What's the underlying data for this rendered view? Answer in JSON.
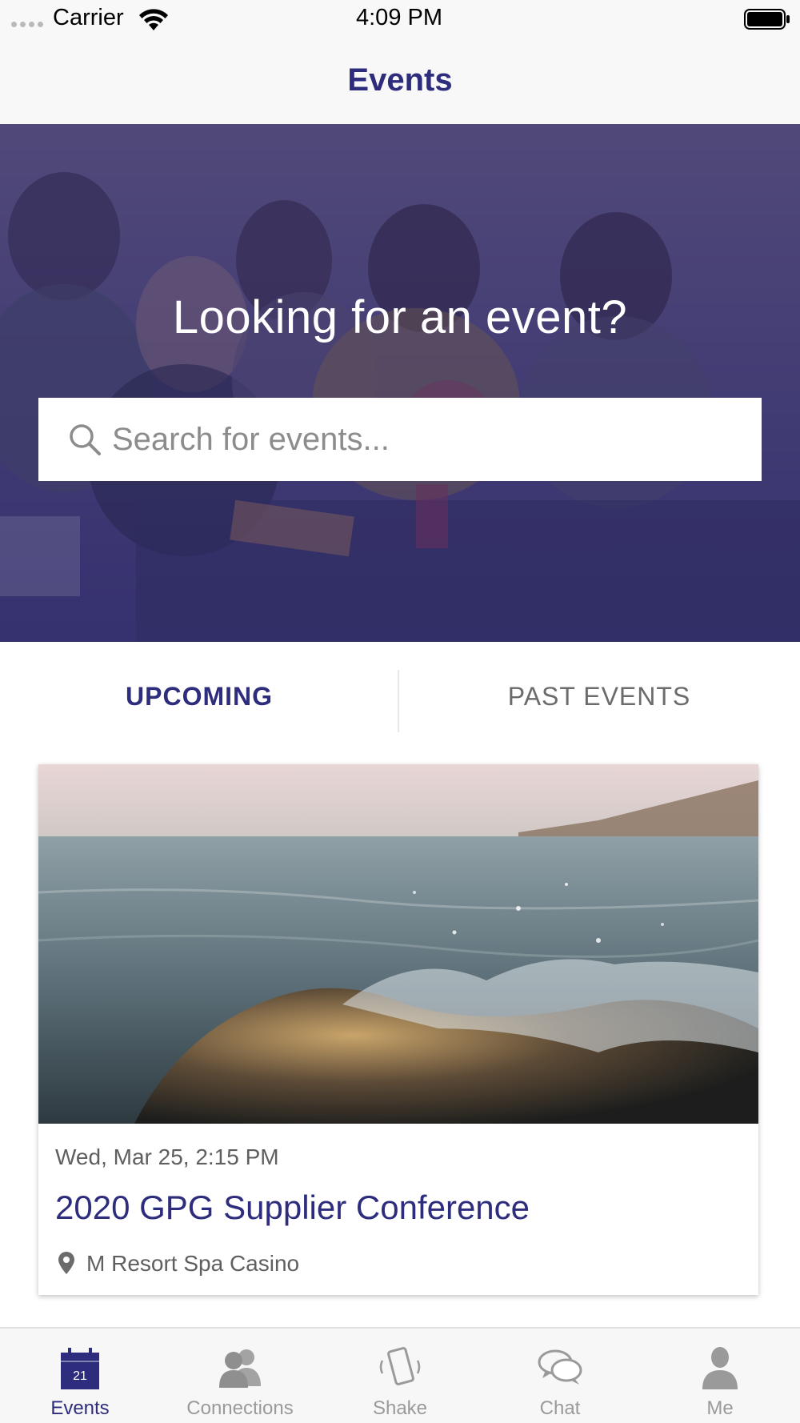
{
  "status_bar": {
    "carrier": "Carrier",
    "time": "4:09 PM"
  },
  "nav": {
    "title": "Events"
  },
  "hero": {
    "headline": "Looking for an event?",
    "search": {
      "placeholder": "Search for events...",
      "value": ""
    }
  },
  "tabs": {
    "upcoming_label": "UPCOMING",
    "past_label": "PAST EVENTS",
    "selected": "UPCOMING"
  },
  "events": [
    {
      "date": "Wed, Mar 25, 2:15 PM",
      "name": "2020 GPG Supplier Conference",
      "venue": "M Resort Spa Casino"
    }
  ],
  "tab_bar": {
    "items": [
      {
        "label": "Events",
        "icon": "calendar-icon",
        "badge": "21",
        "active": true
      },
      {
        "label": "Connections",
        "icon": "people-icon",
        "active": false
      },
      {
        "label": "Shake",
        "icon": "phone-shake-icon",
        "active": false
      },
      {
        "label": "Chat",
        "icon": "chat-icon",
        "active": false
      },
      {
        "label": "Me",
        "icon": "person-icon",
        "active": false
      }
    ]
  },
  "colors": {
    "brand": "#2e2c7c",
    "inactive": "#9a9a9a",
    "hero_overlay": "#302a6e"
  }
}
